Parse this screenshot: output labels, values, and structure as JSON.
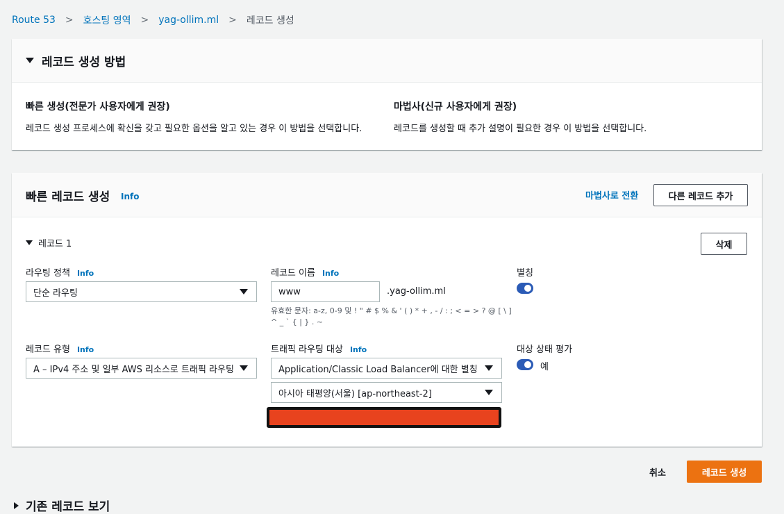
{
  "breadcrumb": {
    "items": [
      "Route 53",
      "호스팅 영역",
      "yag-ollim.ml"
    ],
    "current": "레코드 생성"
  },
  "method_panel": {
    "title": "레코드 생성 방법",
    "quick": {
      "title": "빠른 생성(전문가 사용자에게 권장)",
      "desc": "레코드 생성 프로세스에 확신을 갖고 필요한 옵션을 알고 있는 경우 이 방법을 선택합니다."
    },
    "wizard": {
      "title": "마법사(신규 사용자에게 권장)",
      "desc": "레코드를 생성할 때 추가 설명이 필요한 경우 이 방법을 선택합니다."
    }
  },
  "quick_panel": {
    "title": "빠른 레코드 생성",
    "info": "Info",
    "switch_wizard": "마법사로 전환",
    "add_record": "다른 레코드 추가",
    "record_title": "레코드 1",
    "delete": "삭제",
    "routing_policy": {
      "label": "라우팅 정책",
      "value": "단순 라우팅"
    },
    "record_name": {
      "label": "레코드 이름",
      "value": "www",
      "suffix": ".yag-ollim.ml",
      "hint_line1": "유효한 문자: a-z, 0-9 및 ! \" # $ % & ' ( ) * + , - / : ; < = > ? @ [ \\ ]",
      "hint_line2": "^ _ ` { | } . ~"
    },
    "alias": {
      "label": "별칭"
    },
    "record_type": {
      "label": "레코드 유형",
      "value": "A – IPv4 주소 및 일부 AWS 리소스로 트래픽 라우팅"
    },
    "traffic_target": {
      "label": "트래픽 라우팅 대상",
      "value": "Application/Classic Load Balancer에 대한 별칭",
      "region": "아시아 태평양(서울) [ap-northeast-2]"
    },
    "health": {
      "label": "대상 상태 평가",
      "value": "예"
    }
  },
  "footer": {
    "cancel": "취소",
    "create": "레코드 생성",
    "existing": "기존 레코드 보기"
  },
  "colors": {
    "link": "#0073bb",
    "primary": "#ec7211",
    "toggle": "#2b5bb6"
  }
}
